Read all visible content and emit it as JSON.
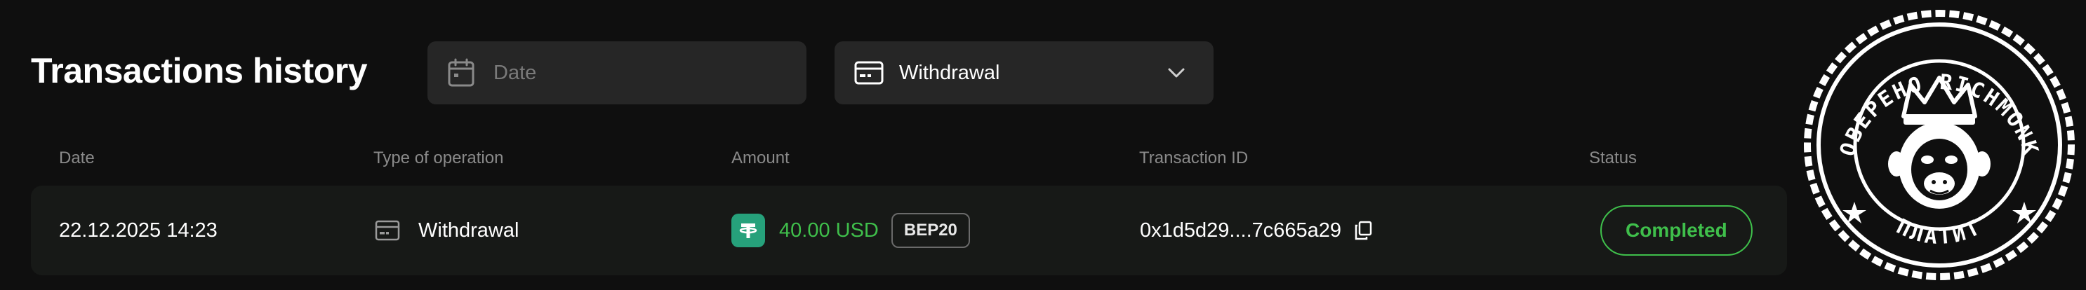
{
  "page": {
    "title": "Transactions history"
  },
  "filters": {
    "date": {
      "placeholder": "Date",
      "value": "",
      "icon": "calendar-icon"
    },
    "type": {
      "selected": "Withdrawal",
      "icon": "card-icon",
      "chevron": "chevron-down-icon"
    }
  },
  "table": {
    "columns": [
      "Date",
      "Type of operation",
      "Amount",
      "Transaction ID",
      "Status"
    ],
    "rows": [
      {
        "date": "22.12.2025 14:23",
        "type": "Withdrawal",
        "type_icon": "card-icon",
        "coin_icon": "tether-icon",
        "amount": "40.00 USD",
        "network": "BEP20",
        "tx_id": "0x1d5d29....7c665a29",
        "copy_icon": "copy-icon",
        "status": "Completed"
      }
    ]
  },
  "stamp": {
    "top_text": "ПРОВЕРЕНО RICHMONKEY",
    "bottom_text": "ПЛАТИТ",
    "icon": "monkey-king-icon"
  },
  "colors": {
    "background": "#0f0f0f",
    "panel": "#262626",
    "row": "#171917",
    "accent_green": "#3fbf4b",
    "muted": "#8a8a8a"
  }
}
